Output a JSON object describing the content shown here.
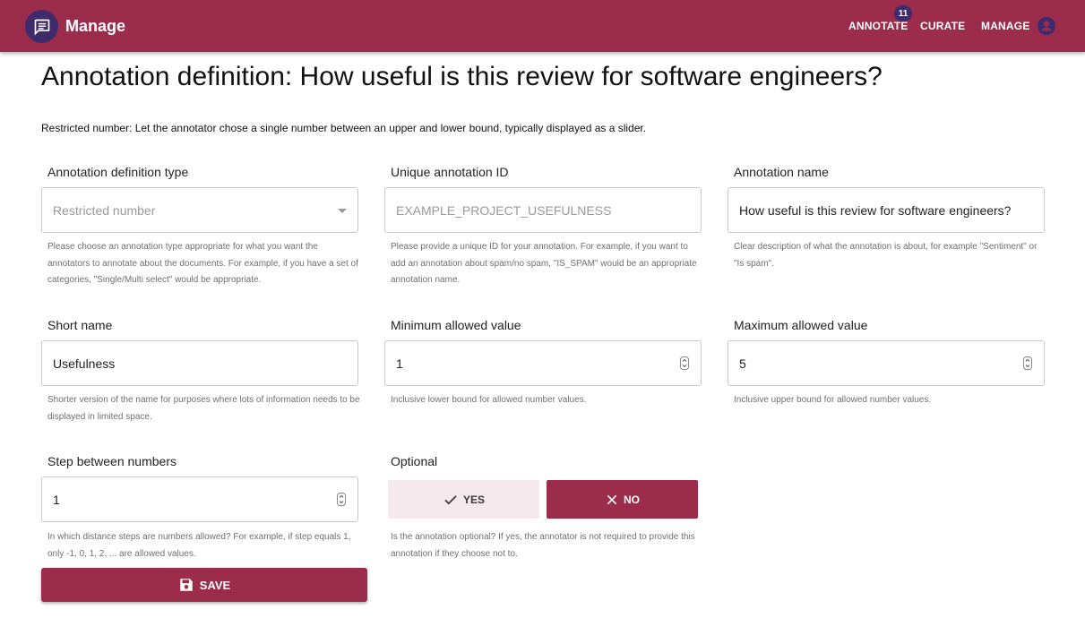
{
  "appbar": {
    "title": "Manage",
    "logo_icon": "chat-icon",
    "nav": [
      {
        "label": "ANNOTATE",
        "badge": "11"
      },
      {
        "label": "CURATE"
      },
      {
        "label": "MANAGE"
      }
    ],
    "account_icon": "account-circle-icon"
  },
  "page": {
    "title": "Annotation definition: How useful is this review for software engineers?",
    "description": "Restricted number: Let the annotator chose a single number between an upper and lower bound, typically displayed as a slider."
  },
  "fields": {
    "type": {
      "label": "Annotation definition type",
      "value": "Restricted number",
      "helper": "Please choose an annotation type appropriate for what you want the annotators to annotate about the documents. For example, if you have a set of categories, \"Single/Multi select\" would be appropriate."
    },
    "id": {
      "label": "Unique annotation ID",
      "value": "EXAMPLE_PROJECT_USEFULNESS",
      "helper": "Please provide a unique ID for your annotation. For example, if you want to add an annotation about spam/no spam, \"IS_SPAM\" would be an appropriate annotation name."
    },
    "name": {
      "label": "Annotation name",
      "value": "How useful is this review for software engineers?",
      "helper": "Clear description of what the annotation is about, for example \"Sentiment\" or \"Is spam\"."
    },
    "short_name": {
      "label": "Short name",
      "value": "Usefulness",
      "helper": "Shorter version of the name for purposes where lots of information needs to be displayed in limited space."
    },
    "min": {
      "label": "Minimum allowed value",
      "value": "1",
      "helper": "Inclusive lower bound for allowed number values."
    },
    "max": {
      "label": "Maximum allowed value",
      "value": "5",
      "helper": "Inclusive upper bound for allowed number values."
    },
    "step": {
      "label": "Step between numbers",
      "value": "1",
      "helper": "In which distance steps are numbers allowed? For example, if step equals 1, only -1, 0, 1, 2, ... are allowed values."
    },
    "optional": {
      "label": "Optional",
      "yes_label": "YES",
      "no_label": "NO",
      "selected": "NO",
      "helper": "Is the annotation optional? If yes, the annotator is not required to provide this annotation if they choose not to."
    }
  },
  "save_button": {
    "label": "SAVE",
    "icon": "save-icon"
  },
  "colors": {
    "primary": "#9b2c4c",
    "secondary": "#3f2a6b",
    "toggle_unselected": "#f6e9ed"
  }
}
